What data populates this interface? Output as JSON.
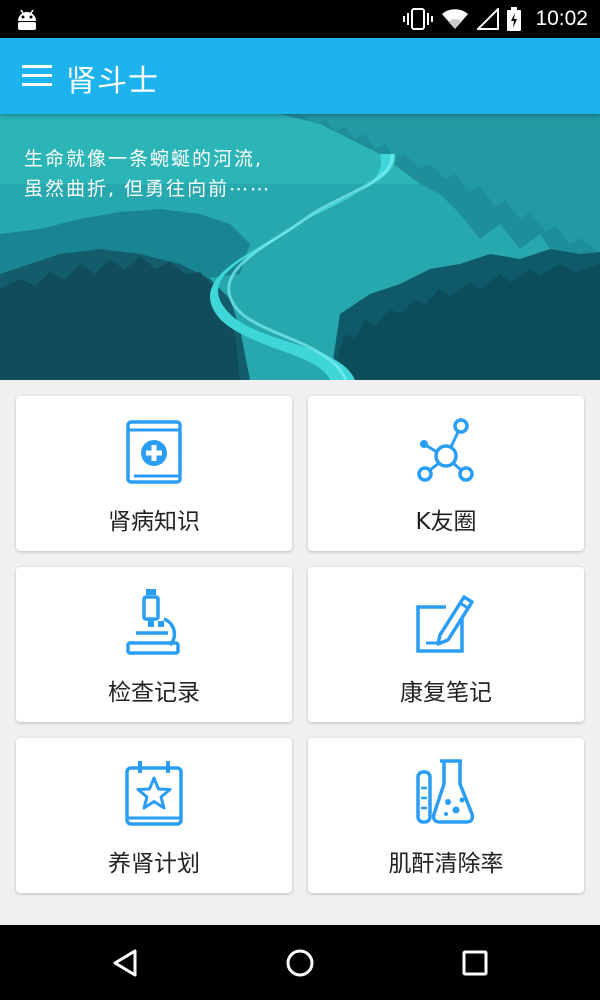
{
  "status_bar": {
    "time": "10:02",
    "icons": [
      "android-icon",
      "vibrate-icon",
      "wifi-icon",
      "signal-icon",
      "battery-charging-icon"
    ]
  },
  "app_bar": {
    "title": "肾斗士",
    "menu_icon": "hamburger-menu-icon"
  },
  "banner": {
    "slogan_line1": "生命就像一条蜿蜒的河流,",
    "slogan_line2": "虽然曲折, 但勇往向前⋯⋯"
  },
  "menu": {
    "items": [
      {
        "label": "肾病知识",
        "icon": "medical-book-icon"
      },
      {
        "label": "K友圈",
        "icon": "network-nodes-icon"
      },
      {
        "label": "检查记录",
        "icon": "microscope-icon"
      },
      {
        "label": "康复笔记",
        "icon": "pencil-notepad-icon"
      },
      {
        "label": "养肾计划",
        "icon": "calendar-star-icon"
      },
      {
        "label": "肌酐清除率",
        "icon": "lab-flask-icon"
      }
    ]
  },
  "colors": {
    "primary": "#1db3ee",
    "icon_blue": "#2a9df4"
  },
  "nav_bar": {
    "buttons": [
      "back-icon",
      "home-icon",
      "recents-icon"
    ]
  }
}
